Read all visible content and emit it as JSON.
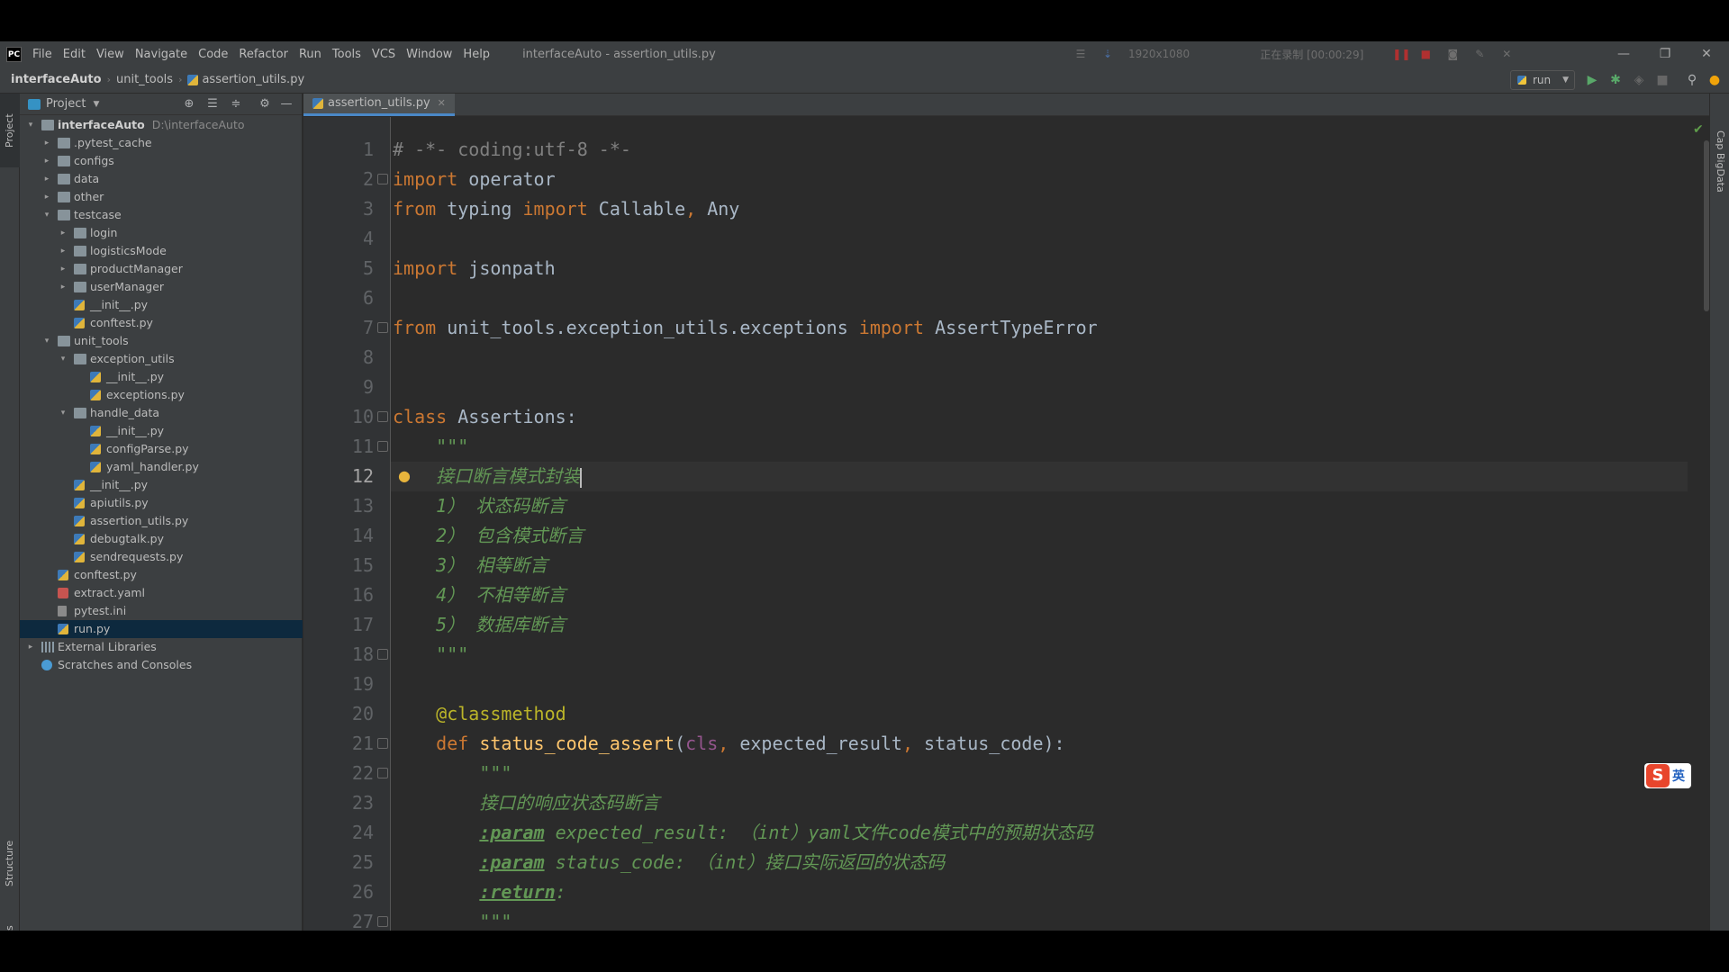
{
  "menu": {
    "items": [
      "File",
      "Edit",
      "View",
      "Navigate",
      "Code",
      "Refactor",
      "Run",
      "Tools",
      "VCS",
      "Window",
      "Help"
    ],
    "window_title": "interfaceAuto - assertion_utils.py"
  },
  "recorder": {
    "resolution": "1920x1080",
    "status": "正在录制 [00:00:29]"
  },
  "breadcrumb": {
    "project": "interfaceAuto",
    "folder": "unit_tools",
    "file": "assertion_utils.py"
  },
  "run_config": {
    "label": "run"
  },
  "left_strip": {
    "project": "Project",
    "structure": "Structure",
    "favorites": "Favorites"
  },
  "right_strip": {
    "bigdata": "Cap BigData"
  },
  "project_panel": {
    "title": "Project"
  },
  "tree": [
    {
      "label": "interfaceAuto",
      "path": "D:\\interfaceAuto",
      "depth": 0,
      "arrow": "down",
      "icon": "folder",
      "root": true
    },
    {
      "label": ".pytest_cache",
      "depth": 1,
      "arrow": "right",
      "icon": "folder"
    },
    {
      "label": "configs",
      "depth": 1,
      "arrow": "right",
      "icon": "folder"
    },
    {
      "label": "data",
      "depth": 1,
      "arrow": "right",
      "icon": "folder"
    },
    {
      "label": "other",
      "depth": 1,
      "arrow": "right",
      "icon": "folder"
    },
    {
      "label": "testcase",
      "depth": 1,
      "arrow": "down",
      "icon": "folder"
    },
    {
      "label": "login",
      "depth": 2,
      "arrow": "right",
      "icon": "folder"
    },
    {
      "label": "logisticsMode",
      "depth": 2,
      "arrow": "right",
      "icon": "folder"
    },
    {
      "label": "productManager",
      "depth": 2,
      "arrow": "right",
      "icon": "folder"
    },
    {
      "label": "userManager",
      "depth": 2,
      "arrow": "right",
      "icon": "folder"
    },
    {
      "label": "__init__.py",
      "depth": 2,
      "arrow": "",
      "icon": "py"
    },
    {
      "label": "conftest.py",
      "depth": 2,
      "arrow": "",
      "icon": "py"
    },
    {
      "label": "unit_tools",
      "depth": 1,
      "arrow": "down",
      "icon": "folder"
    },
    {
      "label": "exception_utils",
      "depth": 2,
      "arrow": "down",
      "icon": "folder"
    },
    {
      "label": "__init__.py",
      "depth": 3,
      "arrow": "",
      "icon": "py"
    },
    {
      "label": "exceptions.py",
      "depth": 3,
      "arrow": "",
      "icon": "py"
    },
    {
      "label": "handle_data",
      "depth": 2,
      "arrow": "down",
      "icon": "folder"
    },
    {
      "label": "__init__.py",
      "depth": 3,
      "arrow": "",
      "icon": "py"
    },
    {
      "label": "configParse.py",
      "depth": 3,
      "arrow": "",
      "icon": "py"
    },
    {
      "label": "yaml_handler.py",
      "depth": 3,
      "arrow": "",
      "icon": "py"
    },
    {
      "label": "__init__.py",
      "depth": 2,
      "arrow": "",
      "icon": "py"
    },
    {
      "label": "apiutils.py",
      "depth": 2,
      "arrow": "",
      "icon": "py"
    },
    {
      "label": "assertion_utils.py",
      "depth": 2,
      "arrow": "",
      "icon": "py"
    },
    {
      "label": "debugtalk.py",
      "depth": 2,
      "arrow": "",
      "icon": "py"
    },
    {
      "label": "sendrequests.py",
      "depth": 2,
      "arrow": "",
      "icon": "py"
    },
    {
      "label": "conftest.py",
      "depth": 1,
      "arrow": "",
      "icon": "py"
    },
    {
      "label": "extract.yaml",
      "depth": 1,
      "arrow": "",
      "icon": "yaml"
    },
    {
      "label": "pytest.ini",
      "depth": 1,
      "arrow": "",
      "icon": "ini"
    },
    {
      "label": "run.py",
      "depth": 1,
      "arrow": "",
      "icon": "py",
      "selected": true
    },
    {
      "label": "External Libraries",
      "depth": 0,
      "arrow": "right",
      "icon": "lib"
    },
    {
      "label": "Scratches and Consoles",
      "depth": 0,
      "arrow": "",
      "icon": "scratch"
    }
  ],
  "editor": {
    "tab_label": "assertion_utils.py",
    "current_line": 12,
    "lines": [
      [
        [
          "cm",
          "# -*- coding:utf-8 -*-"
        ]
      ],
      [
        [
          "kw",
          "import"
        ],
        [
          "",
          " operator"
        ]
      ],
      [
        [
          "kw",
          "from"
        ],
        [
          "",
          " typing "
        ],
        [
          "kw",
          "import"
        ],
        [
          "",
          " Callable"
        ],
        [
          "kw",
          ","
        ],
        [
          "",
          " Any"
        ]
      ],
      [],
      [
        [
          "kw",
          "import"
        ],
        [
          "",
          " jsonpath"
        ]
      ],
      [],
      [
        [
          "kw",
          "from"
        ],
        [
          "",
          " unit_tools.exception_utils.exceptions "
        ],
        [
          "kw",
          "import"
        ],
        [
          "",
          " AssertTypeError"
        ]
      ],
      [],
      [],
      [
        [
          "kw",
          "class"
        ],
        [
          "",
          " Assertions:"
        ]
      ],
      [
        [
          "",
          "    "
        ],
        [
          "doc",
          "\"\"\""
        ]
      ],
      [
        [
          "",
          "    "
        ],
        [
          "doc",
          "接口断言模式封装"
        ],
        [
          "caret",
          ""
        ]
      ],
      [
        [
          "",
          "    "
        ],
        [
          "doc",
          "1） 状态码断言"
        ]
      ],
      [
        [
          "",
          "    "
        ],
        [
          "doc",
          "2） 包含模式断言"
        ]
      ],
      [
        [
          "",
          "    "
        ],
        [
          "doc",
          "3） 相等断言"
        ]
      ],
      [
        [
          "",
          "    "
        ],
        [
          "doc",
          "4） 不相等断言"
        ]
      ],
      [
        [
          "",
          "    "
        ],
        [
          "doc",
          "5） 数据库断言"
        ]
      ],
      [
        [
          "",
          "    "
        ],
        [
          "doc",
          "\"\"\""
        ]
      ],
      [],
      [
        [
          "",
          "    "
        ],
        [
          "deco",
          "@classmethod"
        ]
      ],
      [
        [
          "",
          "    "
        ],
        [
          "kw",
          "def"
        ],
        [
          "",
          " "
        ],
        [
          "fn",
          "status_code_assert"
        ],
        [
          "",
          "("
        ],
        [
          "self",
          "cls"
        ],
        [
          "kw",
          ","
        ],
        [
          "",
          " expected_result"
        ],
        [
          "kw",
          ","
        ],
        [
          "",
          " status_code):"
        ]
      ],
      [
        [
          "",
          "        "
        ],
        [
          "doc",
          "\"\"\""
        ]
      ],
      [
        [
          "",
          "        "
        ],
        [
          "doc",
          "接口的响应状态码断言"
        ]
      ],
      [
        [
          "",
          "        "
        ],
        [
          "doctag",
          ":param"
        ],
        [
          "doc",
          " expected_result: （int）yaml文件code模式中的预期状态码"
        ]
      ],
      [
        [
          "",
          "        "
        ],
        [
          "doctag",
          ":param"
        ],
        [
          "doc",
          " status_code: （int）接口实际返回的状态码"
        ]
      ],
      [
        [
          "",
          "        "
        ],
        [
          "doctag",
          ":return"
        ],
        [
          "doc",
          ":"
        ]
      ],
      [
        [
          "",
          "        "
        ],
        [
          "doc",
          "\"\"\""
        ]
      ]
    ]
  },
  "ime": {
    "logo": "S",
    "mode": "英"
  }
}
